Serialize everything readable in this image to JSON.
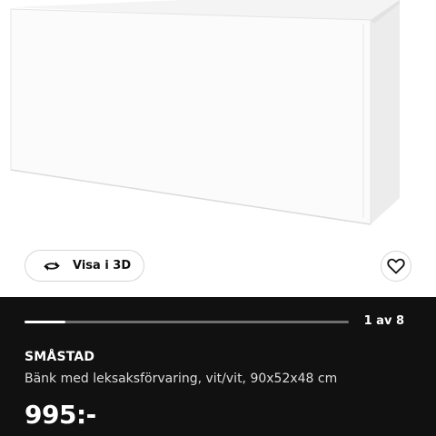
{
  "product_image": {
    "alt": ""
  },
  "view3d": {
    "label": "Visa i 3D",
    "icon": "rotate-3d-icon"
  },
  "favorite": {
    "icon": "heart-outline-icon"
  },
  "gallery": {
    "counter": "1 av 8",
    "current": 1,
    "total": 8
  },
  "product": {
    "name": "SMÅSTAD",
    "description": "Bänk med leksaksförvaring, vit/vit, 90x52x48 cm",
    "price": "995:-"
  },
  "colors": {
    "panel_background": "#111111",
    "text_primary": "#ffffff"
  }
}
